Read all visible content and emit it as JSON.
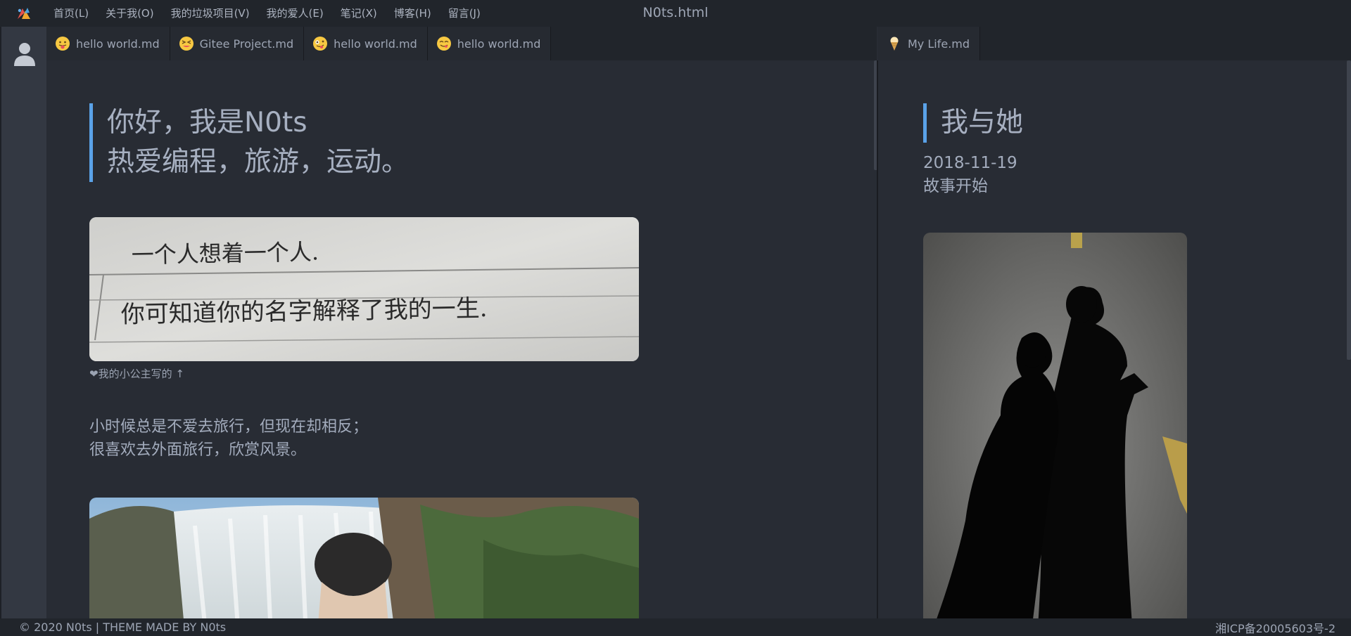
{
  "window": {
    "title": "N0ts.html"
  },
  "menu": {
    "items": [
      {
        "label": "首页(L)"
      },
      {
        "label": "关于我(O)"
      },
      {
        "label": "我的垃圾项目(V)"
      },
      {
        "label": "我的爱人(E)"
      },
      {
        "label": "笔记(X)"
      },
      {
        "label": "博客(H)"
      },
      {
        "label": "留言(J)"
      }
    ]
  },
  "tabs_left": [
    {
      "label": "hello world.md",
      "icon": "tongue-out-emoji-icon"
    },
    {
      "label": "Gitee Project.md",
      "icon": "squint-emoji-icon"
    },
    {
      "label": "hello world.md",
      "icon": "zany-emoji-icon"
    },
    {
      "label": "hello world.md",
      "icon": "yum-emoji-icon"
    }
  ],
  "tabs_right": [
    {
      "label": "My Life.md",
      "icon": "ice-cream-icon"
    }
  ],
  "left_pane": {
    "intro_line1": "你好，我是N0ts",
    "intro_line2": "热爱编程，旅游，运动。",
    "handwriting_line1": "一个人想着一个人.",
    "handwriting_line2": "你可知道你的名字解释了我的一生.",
    "caption": "❤我的小公主写的 ↑",
    "para_line1": "小时候总是不爱去旅行，但现在却相反；",
    "para_line2": "很喜欢去外面旅行，欣赏风景。"
  },
  "right_pane": {
    "title": "我与她",
    "date": "2018-11-19",
    "subtitle": "故事开始"
  },
  "status": {
    "left": "© 2020 N0ts | THEME MADE BY N0ts",
    "right": "湘ICP备20005603号-2"
  },
  "colors": {
    "accent": "#5aa2e8",
    "background": "#282c34",
    "bar": "#21252b"
  }
}
